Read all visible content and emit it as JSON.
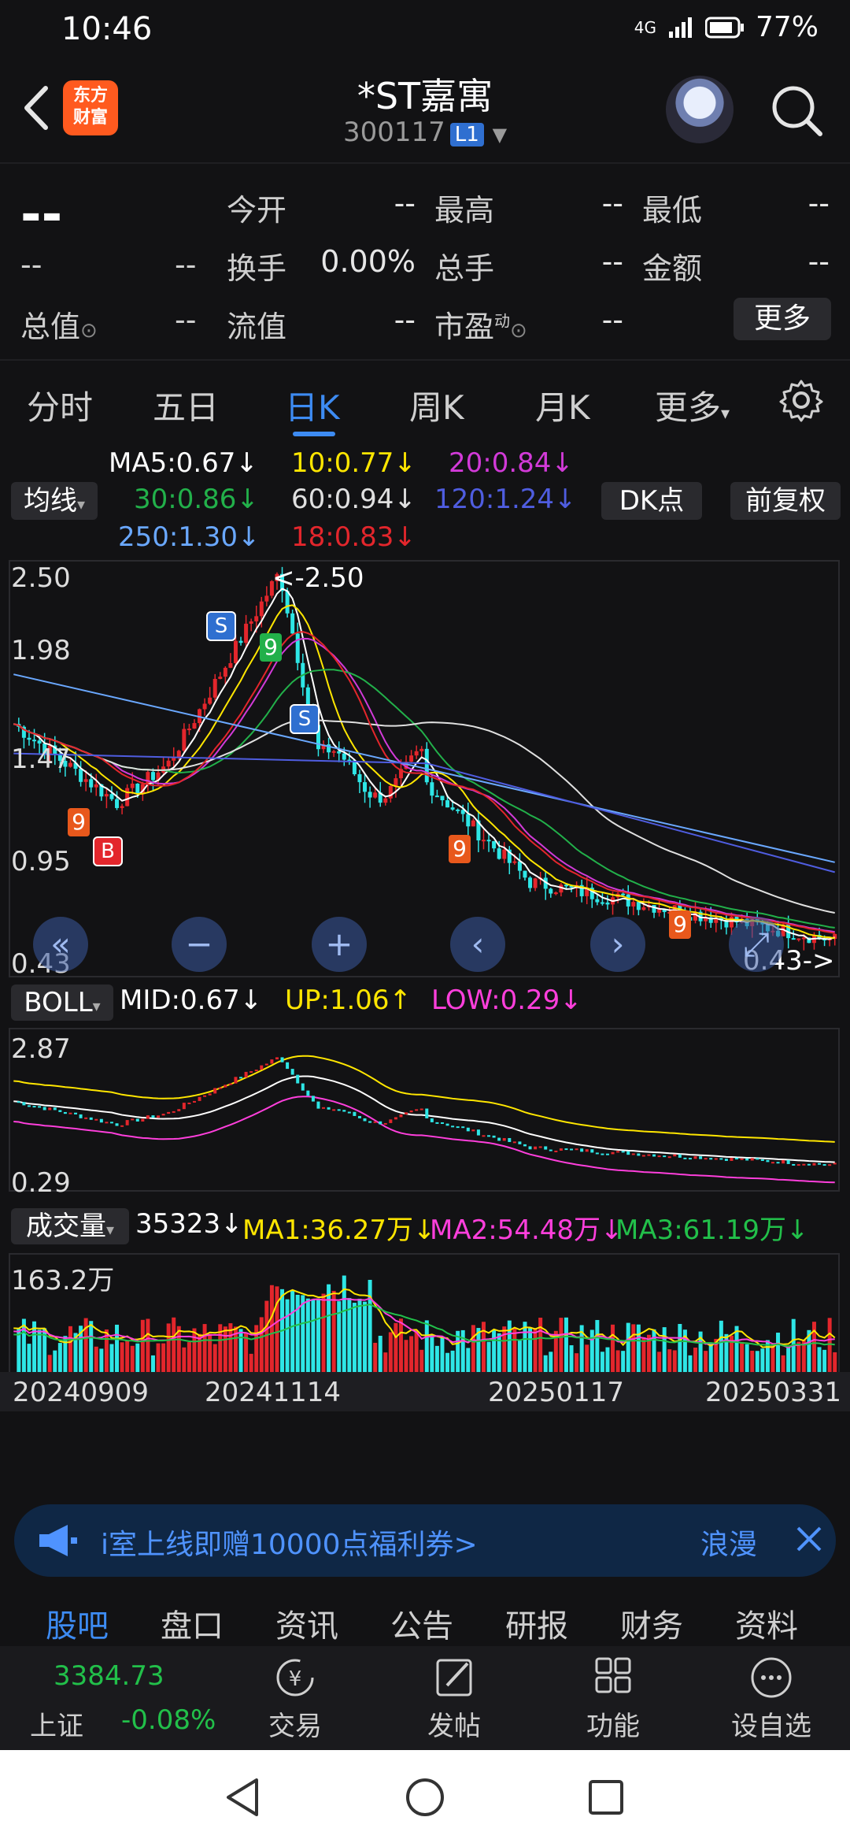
{
  "status": {
    "time": "10:46",
    "network": "4G",
    "battery": "77%"
  },
  "header": {
    "logo_line1": "东方",
    "logo_line2": "财富",
    "title": "*ST嘉寓",
    "code": "300117",
    "level_badge": "L1"
  },
  "quote": {
    "price": "--",
    "change": "--",
    "change_pct": "--",
    "total_value_label": "总值",
    "total_value": "--",
    "fields": [
      {
        "label": "今开",
        "value": "--"
      },
      {
        "label": "最高",
        "value": "--"
      },
      {
        "label": "最低",
        "value": "--"
      },
      {
        "label": "换手",
        "value": "0.00%"
      },
      {
        "label": "总手",
        "value": "--"
      },
      {
        "label": "金额",
        "value": "--"
      },
      {
        "label": "流值",
        "value": "--"
      },
      {
        "label": "市盈",
        "value": "--"
      }
    ],
    "pe_superscript": "动",
    "more_label": "更多"
  },
  "tabs": [
    {
      "label": "分时"
    },
    {
      "label": "五日"
    },
    {
      "label": "日K",
      "active": true
    },
    {
      "label": "周K"
    },
    {
      "label": "月K"
    },
    {
      "label": "更多"
    }
  ],
  "ma_panel": {
    "selector": "均线",
    "dk_button": "DK点",
    "adjust_button": "前复权",
    "items": [
      {
        "text": "MA5:0.67↓",
        "color": "#ffffff"
      },
      {
        "text": "10:0.77↓",
        "color": "#ffe600"
      },
      {
        "text": "20:0.84↓",
        "color": "#d23ad8"
      },
      {
        "text": "30:0.86↓",
        "color": "#22b04a"
      },
      {
        "text": "60:0.94↓",
        "color": "#e0e0e0"
      },
      {
        "text": "120:1.24↓",
        "color": "#4f5de0"
      },
      {
        "text": "250:1.30↓",
        "color": "#6aa8ff"
      },
      {
        "text": "18:0.83↓",
        "color": "#e3262c"
      }
    ]
  },
  "kline": {
    "y_ticks": [
      "2.50",
      "1.98",
      "1.47",
      "0.95",
      "0.43"
    ],
    "high_marker": "<-2.50",
    "low_marker": "0.43->",
    "signal_b": "B",
    "signal_s": "S",
    "signal_9": "9"
  },
  "boll": {
    "selector": "BOLL",
    "mid": "MID:0.67↓",
    "up": "UP:1.06↑",
    "low": "LOW:0.29↓",
    "y_top": "2.87",
    "y_bottom": "0.29"
  },
  "volume": {
    "selector": "成交量",
    "value": "35323↓",
    "ma1": "MA1:36.27万↓",
    "ma2": "MA2:54.48万↓",
    "ma3": "MA3:61.19万↓",
    "y_top": "163.2万"
  },
  "x_dates": [
    "20240909",
    "20241114",
    "20250117",
    "20250331"
  ],
  "colors": {
    "up": "#e3262c",
    "down": "#2ee6e6",
    "accent": "#3d8bf2"
  },
  "ad": {
    "text": "i室上线即赠10000点福利券>",
    "tag": "浪漫"
  },
  "sections": [
    "股吧",
    "盘口",
    "资讯",
    "公告",
    "研报",
    "财务",
    "资料"
  ],
  "bottom": {
    "index_value": "3384.73",
    "index_name": "上证",
    "index_change": "-0.08%",
    "items": [
      "交易",
      "发帖",
      "功能",
      "设自选"
    ]
  }
}
